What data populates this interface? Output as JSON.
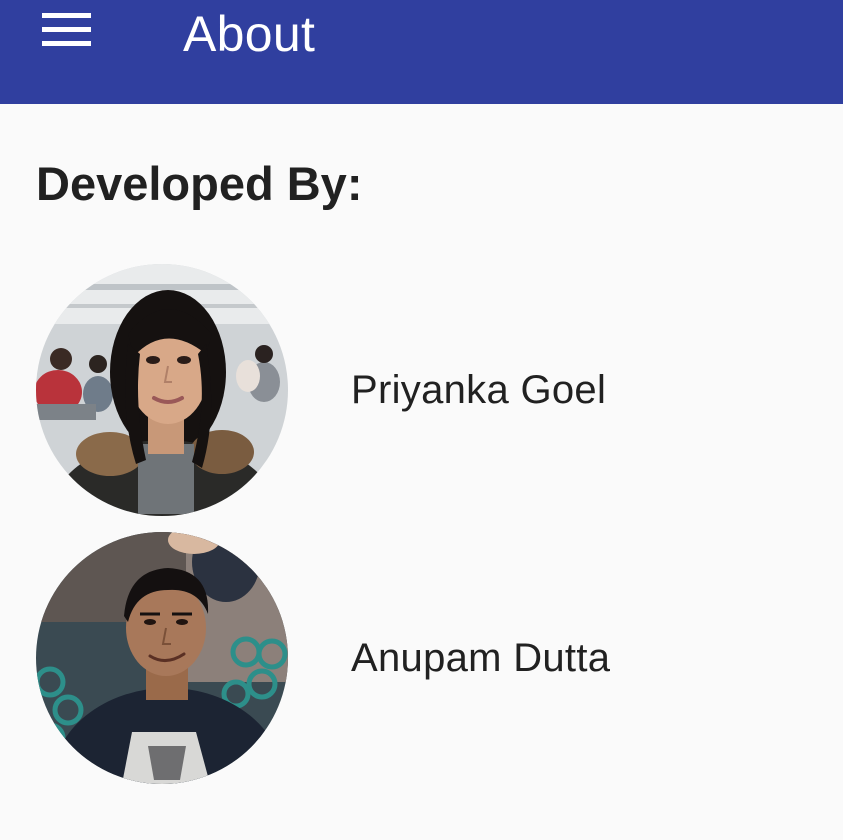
{
  "app_bar": {
    "title": "About",
    "menu_icon": "hamburger-menu-icon",
    "color": "#303f9f"
  },
  "section": {
    "heading": "Developed By:"
  },
  "developers": [
    {
      "name": "Priyanka Goel",
      "avatar": "profile-photo"
    },
    {
      "name": "Anupam Dutta",
      "avatar": "profile-photo"
    }
  ]
}
